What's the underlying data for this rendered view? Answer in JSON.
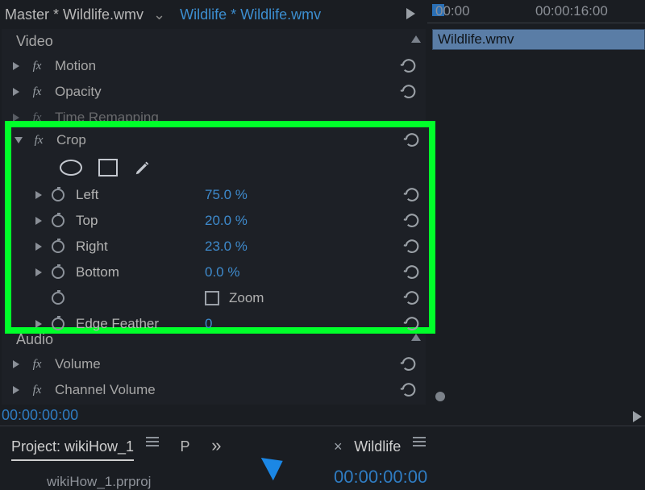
{
  "topbar": {
    "master_label": "Master * Wildlife.wmv",
    "clip_tab": "Wildlife * Wildlife.wmv"
  },
  "timeline": {
    "t1": "00:00",
    "t2": "00:00:16:00",
    "clip_name": "Wildlife.wmv"
  },
  "sections": {
    "video_label": "Video",
    "audio_label": "Audio"
  },
  "video_effects": {
    "motion": "Motion",
    "opacity": "Opacity",
    "time_remapping": "Time Remapping"
  },
  "crop": {
    "title": "Crop",
    "left_label": "Left",
    "left_value": "75.0 %",
    "top_label": "Top",
    "top_value": "20.0 %",
    "right_label": "Right",
    "right_value": "23.0 %",
    "bottom_label": "Bottom",
    "bottom_value": "0.0 %",
    "zoom_label": "Zoom",
    "edge_feather_label": "Edge Feather",
    "edge_feather_value": "0"
  },
  "audio_effects": {
    "volume": "Volume",
    "channel_volume": "Channel Volume"
  },
  "timecode": "00:00:00:00",
  "project_panel": {
    "tab": "Project: wikiHow_1",
    "extra": "P",
    "file": "wikiHow_1.prproj"
  },
  "source_panel": {
    "tab": "Wildlife",
    "timecode": "00:00:00:00"
  }
}
